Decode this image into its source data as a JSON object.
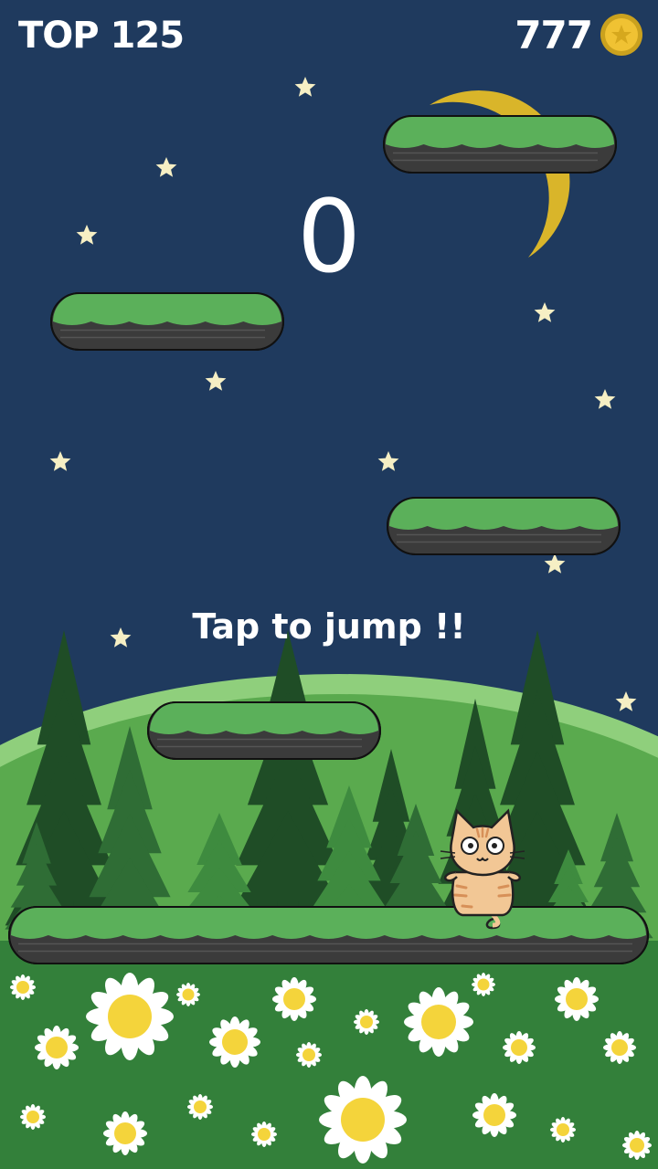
{
  "hud": {
    "best_label": "TOP 125",
    "coins": "777",
    "coin_icon": "star-coin-icon"
  },
  "score": "0",
  "hint": "Tap to jump !!",
  "character": "tabby-cat",
  "colors": {
    "sky": "#1f3a5e",
    "moon": "#d9b52a",
    "star": "#f6efc4",
    "platform_top": "#5bb05a",
    "platform_band": "#3f8f46",
    "platform_base": "#3b3b3b",
    "hill_light": "#8fcf7c",
    "hill": "#5aaa4e",
    "tree_dark": "#1f4d26",
    "tree_mid": "#2f6d35",
    "tree_light": "#3e8b3f",
    "meadow": "#33803a",
    "daisy_petal": "#ffffff",
    "daisy_center": "#f4d43b",
    "cat_fur": "#f2c795",
    "cat_stripe": "#d79058"
  }
}
